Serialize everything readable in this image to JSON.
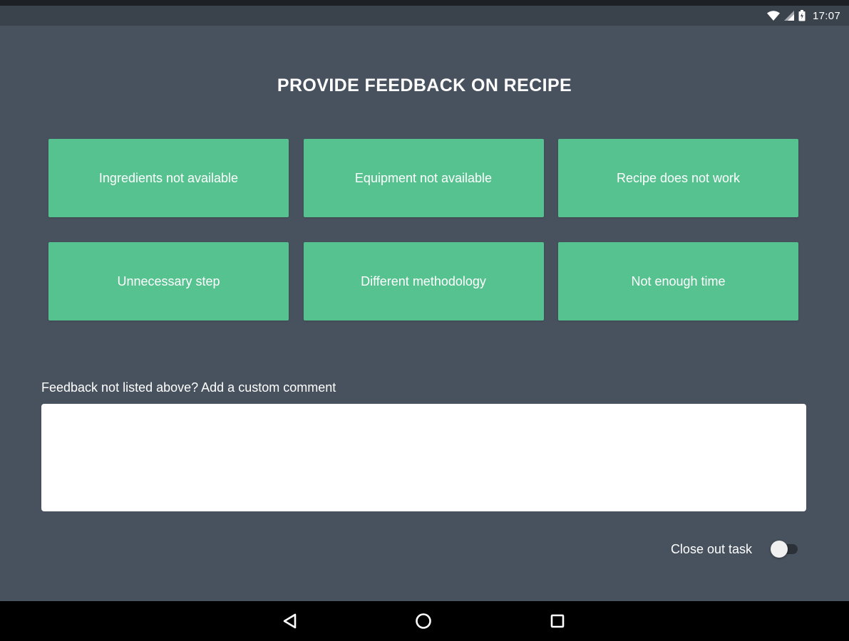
{
  "status_bar": {
    "icons": [
      "wifi-icon",
      "cell-signal-icon",
      "battery-icon"
    ],
    "time": "17:07"
  },
  "page": {
    "title": "PROVIDE FEEDBACK ON RECIPE"
  },
  "feedback_options": [
    {
      "label": "Ingredients not available"
    },
    {
      "label": "Equipment not available"
    },
    {
      "label": "Recipe does not work"
    },
    {
      "label": "Unnecessary step"
    },
    {
      "label": "Different methodology"
    },
    {
      "label": "Not enough time"
    }
  ],
  "comment": {
    "label": "Feedback not listed above? Add a custom comment",
    "value": "",
    "placeholder": ""
  },
  "close_task": {
    "label": "Close out task",
    "enabled": false
  },
  "nav_bar": {
    "icons": [
      "back-icon",
      "home-icon",
      "recents-icon"
    ]
  },
  "colors": {
    "background": "#48525e",
    "status_bar": "#3a424c",
    "tile": "#56c28f",
    "nav_bar": "#000000"
  }
}
